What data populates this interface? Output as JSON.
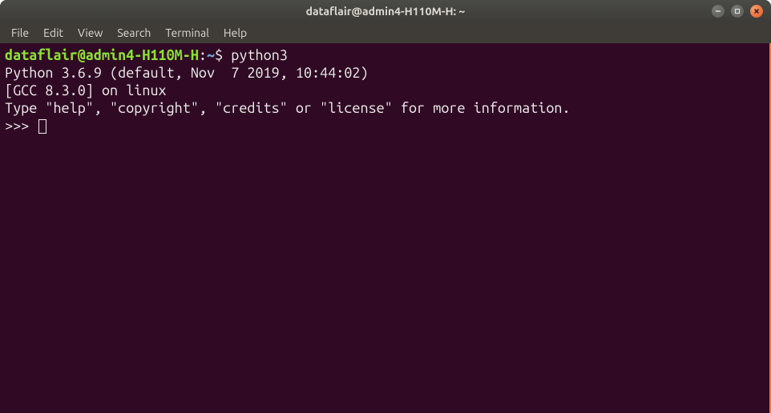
{
  "window": {
    "title": "dataflair@admin4-H110M-H: ~"
  },
  "menubar": {
    "items": [
      "File",
      "Edit",
      "View",
      "Search",
      "Terminal",
      "Help"
    ]
  },
  "prompt": {
    "user_host": "dataflair@admin4-H110M-H",
    "separator": ":",
    "path": "~",
    "dollar": "$"
  },
  "session": {
    "command": "python3",
    "output_lines": [
      "Python 3.6.9 (default, Nov  7 2019, 10:44:02) ",
      "[GCC 8.3.0] on linux",
      "Type \"help\", \"copyright\", \"credits\" or \"license\" for more information."
    ],
    "repl_prompt": ">>> "
  }
}
